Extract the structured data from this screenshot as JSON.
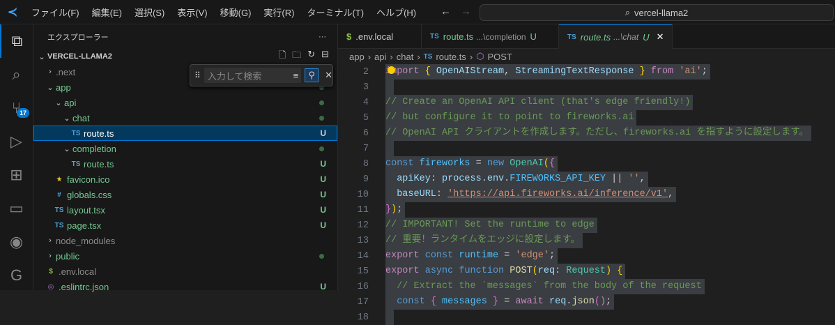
{
  "menu": [
    "ファイル(F)",
    "編集(E)",
    "選択(S)",
    "表示(V)",
    "移動(G)",
    "実行(R)",
    "ターミナル(T)",
    "ヘルプ(H)"
  ],
  "search_text": "vercel-llama2",
  "activity": [
    {
      "icon": "files-icon",
      "glyph": "⧉"
    },
    {
      "icon": "search-icon",
      "glyph": "⌕"
    },
    {
      "icon": "source-control-icon",
      "glyph": "⑂",
      "badge": "17"
    },
    {
      "icon": "run-debug-icon",
      "glyph": "▷"
    },
    {
      "icon": "extensions-icon",
      "glyph": "⊞"
    },
    {
      "icon": "remote-explorer-icon",
      "glyph": "▭"
    },
    {
      "icon": "github-icon",
      "glyph": "◉"
    },
    {
      "icon": "gitlens-icon",
      "glyph": "G"
    }
  ],
  "sidebar": {
    "title": "エクスプローラー",
    "more": "···",
    "project": "VERCEL-LLAMA2",
    "find_placeholder": "入力して検索",
    "tree": [
      {
        "name": ".next",
        "depth": 1,
        "chev": "›",
        "color": "#8b8b8b"
      },
      {
        "name": "app",
        "depth": 1,
        "chev": "⌄",
        "color": "#73c991",
        "dot": true
      },
      {
        "name": "api",
        "depth": 2,
        "chev": "⌄",
        "color": "#73c991",
        "dot": true
      },
      {
        "name": "chat",
        "depth": 3,
        "chev": "⌄",
        "color": "#73c991",
        "dot": true
      },
      {
        "name": "route.ts",
        "depth": 4,
        "icon": "TS",
        "iconColor": "#4d9fd6",
        "color": "#ffffff",
        "status": "U",
        "selected": true
      },
      {
        "name": "completion",
        "depth": 3,
        "chev": "⌄",
        "color": "#73c991",
        "dot": true
      },
      {
        "name": "route.ts",
        "depth": 4,
        "icon": "TS",
        "iconColor": "#4d9fd6",
        "color": "#73c991",
        "status": "U"
      },
      {
        "name": "favicon.ico",
        "depth": 2,
        "icon": "★",
        "iconColor": "#e8c93a",
        "color": "#73c991",
        "status": "U"
      },
      {
        "name": "globals.css",
        "depth": 2,
        "icon": "#",
        "iconColor": "#4d9fd6",
        "color": "#73c991",
        "status": "U"
      },
      {
        "name": "layout.tsx",
        "depth": 2,
        "icon": "TS",
        "iconColor": "#4d9fd6",
        "color": "#73c991",
        "status": "U"
      },
      {
        "name": "page.tsx",
        "depth": 2,
        "icon": "TS",
        "iconColor": "#4d9fd6",
        "color": "#73c991",
        "status": "U"
      },
      {
        "name": "node_modules",
        "depth": 1,
        "chev": "›",
        "color": "#8b8b8b"
      },
      {
        "name": "public",
        "depth": 1,
        "chev": "›",
        "color": "#73c991",
        "dot": true
      },
      {
        "name": ".env.local",
        "depth": 1,
        "icon": "$",
        "iconColor": "#8dc149",
        "color": "#8b8b8b"
      },
      {
        "name": ".eslintrc.json",
        "depth": 1,
        "icon": "◎",
        "iconColor": "#a074c4",
        "color": "#73c991",
        "status": "U"
      }
    ]
  },
  "tabs": [
    {
      "icon": "$",
      "label": ".env.local",
      "path": "",
      "status": ""
    },
    {
      "icon": "TS",
      "label": "route.ts",
      "path": "...\\completion",
      "status": "U"
    },
    {
      "icon": "TS",
      "label": "route.ts",
      "path": "...\\chat",
      "status": "U",
      "active": true,
      "close": "✕"
    }
  ],
  "breadcrumb": [
    "app",
    "api",
    "chat",
    "route.ts",
    "POST"
  ],
  "code": [
    {
      "n": "2",
      "t": [
        [
          "import",
          "#c586c0"
        ],
        [
          " { ",
          "#ffd700"
        ],
        [
          "OpenAIStream",
          "#9cdcfe"
        ],
        [
          ", ",
          "#ccc"
        ],
        [
          "StreamingTextResponse",
          "#9cdcfe"
        ],
        [
          " } ",
          "#ffd700"
        ],
        [
          "from",
          "#c586c0"
        ],
        [
          " ",
          "#ccc"
        ],
        [
          "'ai'",
          "#ce9178"
        ],
        [
          ";",
          "#ccc"
        ]
      ]
    },
    {
      "n": "3",
      "t": [
        [
          " ",
          "#ccc"
        ]
      ]
    },
    {
      "n": "4",
      "t": [
        [
          "// Create an OpenAI API client (that's edge friendly!)",
          "#6a9955"
        ]
      ]
    },
    {
      "n": "5",
      "t": [
        [
          "// but configure it to point to fireworks.ai",
          "#6a9955"
        ]
      ]
    },
    {
      "n": "6",
      "t": [
        [
          "// OpenAI API クライアントを作成します。ただし、fireworks.ai を指すように設定します。",
          "#6a9955"
        ]
      ]
    },
    {
      "n": "7",
      "t": [
        [
          " ",
          "#ccc"
        ]
      ]
    },
    {
      "n": "8",
      "t": [
        [
          "const",
          "#569cd6"
        ],
        [
          " ",
          "#ccc"
        ],
        [
          "fireworks",
          "#4fc1ff"
        ],
        [
          " = ",
          "#ccc"
        ],
        [
          "new",
          "#569cd6"
        ],
        [
          " ",
          "#ccc"
        ],
        [
          "OpenAI",
          "#4ec9b0"
        ],
        [
          "(",
          "#ffd700"
        ],
        [
          "{",
          "#da70d6"
        ]
      ]
    },
    {
      "n": "9",
      "t": [
        [
          "  apiKey",
          "#9cdcfe"
        ],
        [
          ": ",
          "#ccc"
        ],
        [
          "process",
          "#9cdcfe"
        ],
        [
          ".",
          "#ccc"
        ],
        [
          "env",
          "#9cdcfe"
        ],
        [
          ".",
          "#ccc"
        ],
        [
          "FIREWORKS_API_KEY",
          "#4fc1ff"
        ],
        [
          " || ",
          "#ccc"
        ],
        [
          "''",
          "#ce9178"
        ],
        [
          ",",
          "#ccc"
        ]
      ]
    },
    {
      "n": "10",
      "t": [
        [
          "  baseURL",
          "#9cdcfe"
        ],
        [
          ": ",
          "#ccc"
        ],
        [
          "'https://api.fireworks.ai/inference/v1'",
          "#ce9178"
        ],
        [
          ",",
          "#ccc"
        ]
      ]
    },
    {
      "n": "11",
      "t": [
        [
          "}",
          "#da70d6"
        ],
        [
          ")",
          "#ffd700"
        ],
        [
          ";",
          "#ccc"
        ]
      ]
    },
    {
      "n": "12",
      "t": [
        [
          "// IMPORTANT! Set the runtime to edge",
          "#6a9955"
        ]
      ]
    },
    {
      "n": "13",
      "t": [
        [
          "// 重要！ランタイムをエッジに設定します。",
          "#6a9955"
        ]
      ]
    },
    {
      "n": "14",
      "t": [
        [
          "export",
          "#c586c0"
        ],
        [
          " ",
          "#ccc"
        ],
        [
          "const",
          "#569cd6"
        ],
        [
          " ",
          "#ccc"
        ],
        [
          "runtime",
          "#4fc1ff"
        ],
        [
          " = ",
          "#ccc"
        ],
        [
          "'edge'",
          "#ce9178"
        ],
        [
          ";",
          "#ccc"
        ]
      ]
    },
    {
      "n": "15",
      "t": [
        [
          "export",
          "#c586c0"
        ],
        [
          " ",
          "#ccc"
        ],
        [
          "async",
          "#569cd6"
        ],
        [
          " ",
          "#ccc"
        ],
        [
          "function",
          "#569cd6"
        ],
        [
          " ",
          "#ccc"
        ],
        [
          "POST",
          "#dcdcaa"
        ],
        [
          "(",
          "#ffd700"
        ],
        [
          "req",
          "#9cdcfe"
        ],
        [
          ": ",
          "#ccc"
        ],
        [
          "Request",
          "#4ec9b0"
        ],
        [
          ") ",
          "#ffd700"
        ],
        [
          "{",
          "#ffd700"
        ]
      ]
    },
    {
      "n": "16",
      "t": [
        [
          "  // Extract the `messages` from the body of the request",
          "#6a9955"
        ]
      ]
    },
    {
      "n": "17",
      "t": [
        [
          "  ",
          "#ccc"
        ],
        [
          "const",
          "#569cd6"
        ],
        [
          " ",
          "#ccc"
        ],
        [
          "{",
          "#da70d6"
        ],
        [
          " ",
          "#ccc"
        ],
        [
          "messages",
          "#4fc1ff"
        ],
        [
          " ",
          "#ccc"
        ],
        [
          "}",
          "#da70d6"
        ],
        [
          " = ",
          "#ccc"
        ],
        [
          "await",
          "#c586c0"
        ],
        [
          " ",
          "#ccc"
        ],
        [
          "req",
          "#9cdcfe"
        ],
        [
          ".",
          "#ccc"
        ],
        [
          "json",
          "#dcdcaa"
        ],
        [
          "()",
          "#da70d6"
        ],
        [
          ";",
          "#ccc"
        ]
      ]
    },
    {
      "n": "18",
      "t": [
        [
          " ",
          "#ccc"
        ]
      ]
    }
  ]
}
